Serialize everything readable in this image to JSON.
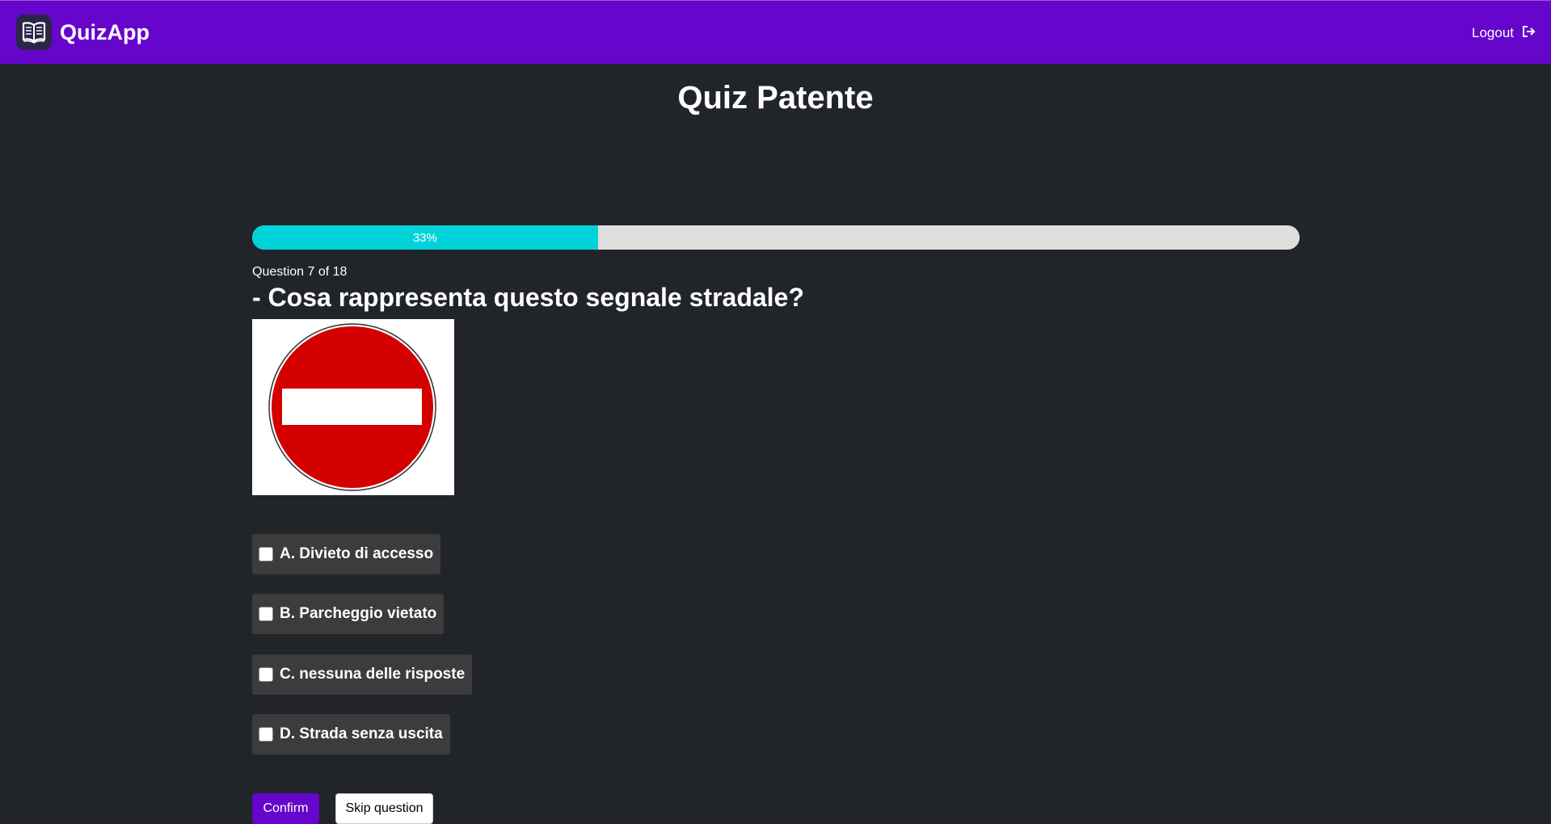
{
  "navbar": {
    "brand": "QuizApp",
    "logo_icon": "open-book-icon",
    "logout_label": "Logout",
    "logout_icon": "sign-out-icon",
    "color": "#6605cc"
  },
  "quiz": {
    "title": "Quiz Patente",
    "progress_label": "33%",
    "progress_fraction": 0.33,
    "counter": "Question 7 of 18",
    "question": "- Cosa rappresenta questo segnale stradale?",
    "image": "no-entry-road-sign",
    "options": [
      {
        "label": "A. Divieto di accesso",
        "checked": false
      },
      {
        "label": "B. Parcheggio vietato",
        "checked": false
      },
      {
        "label": "C. nessuna delle risposte",
        "checked": false
      },
      {
        "label": "D. Strada senza uscita",
        "checked": false
      }
    ],
    "confirm_label": "Confirm",
    "skip_label": "Skip question"
  },
  "colors": {
    "progress": "#00d3d9",
    "background": "#212429",
    "option_bg": "#3c3c3c"
  }
}
